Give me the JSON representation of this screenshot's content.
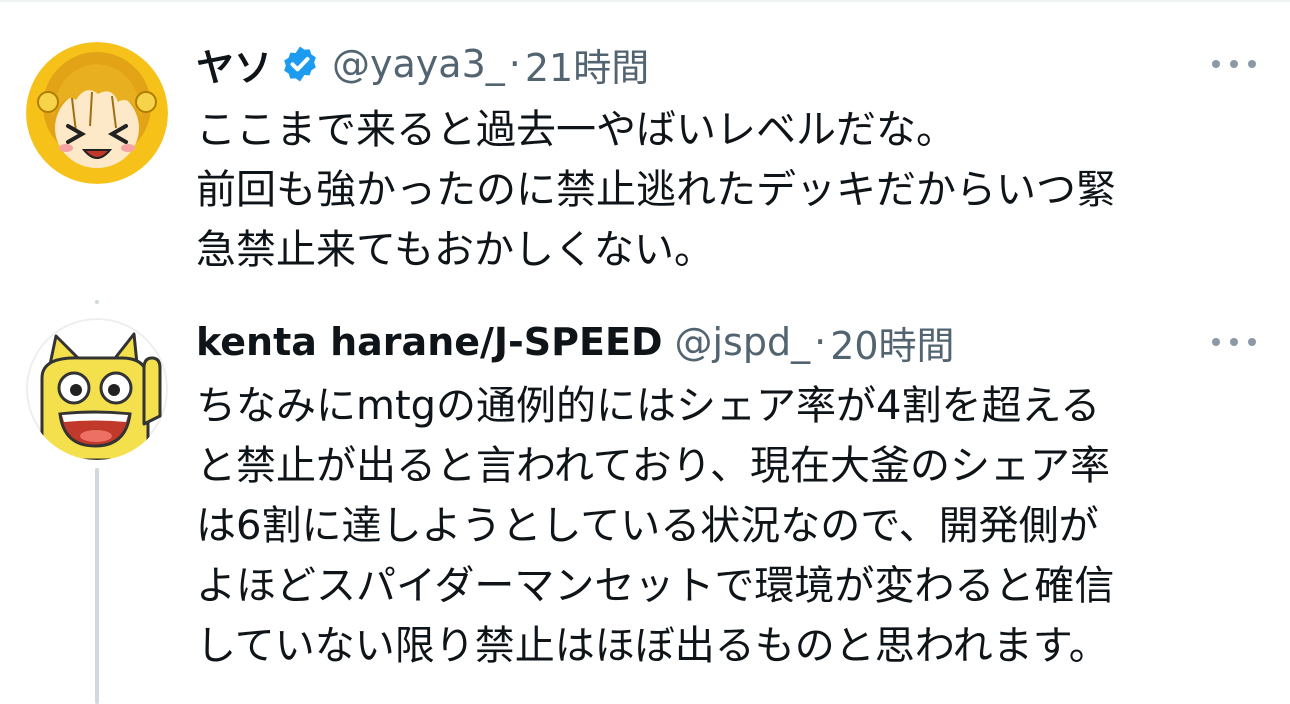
{
  "tweets": [
    {
      "display_name": "ヤソ",
      "verified": true,
      "handle": "@yaya3_",
      "separator": "·",
      "timestamp": "21時間",
      "body_lines": [
        "ここまで来ると過去一やばいレベルだな。",
        "前回も強かったのに禁止逃れたデッキだからいつ緊",
        "急禁止来てもおかしくない。"
      ],
      "avatar_icon": "anime-girl-avatar-icon",
      "more_icon": "more-horizontal-icon"
    },
    {
      "display_name": "kenta harane/J-SPEED",
      "verified": false,
      "handle": "@jspd_",
      "separator": "·",
      "timestamp": "20時間",
      "body_lines": [
        "ちなみにmtgの通例的にはシェア率が4割を超える",
        "と禁止が出ると言われており、現在大釜のシェア率",
        "は6割に達しようとしている状況なので、開発側が",
        "よほどスパイダーマンセットで環境が変わると確信",
        "していない限り禁止はほぼ出るものと思われます。"
      ],
      "avatar_icon": "yellow-cat-avatar-icon",
      "more_icon": "more-horizontal-icon"
    }
  ],
  "colors": {
    "text_primary": "#0f1419",
    "text_secondary": "#536471",
    "verified_blue": "#1d9bf0",
    "thread_line": "#cfd9de"
  }
}
